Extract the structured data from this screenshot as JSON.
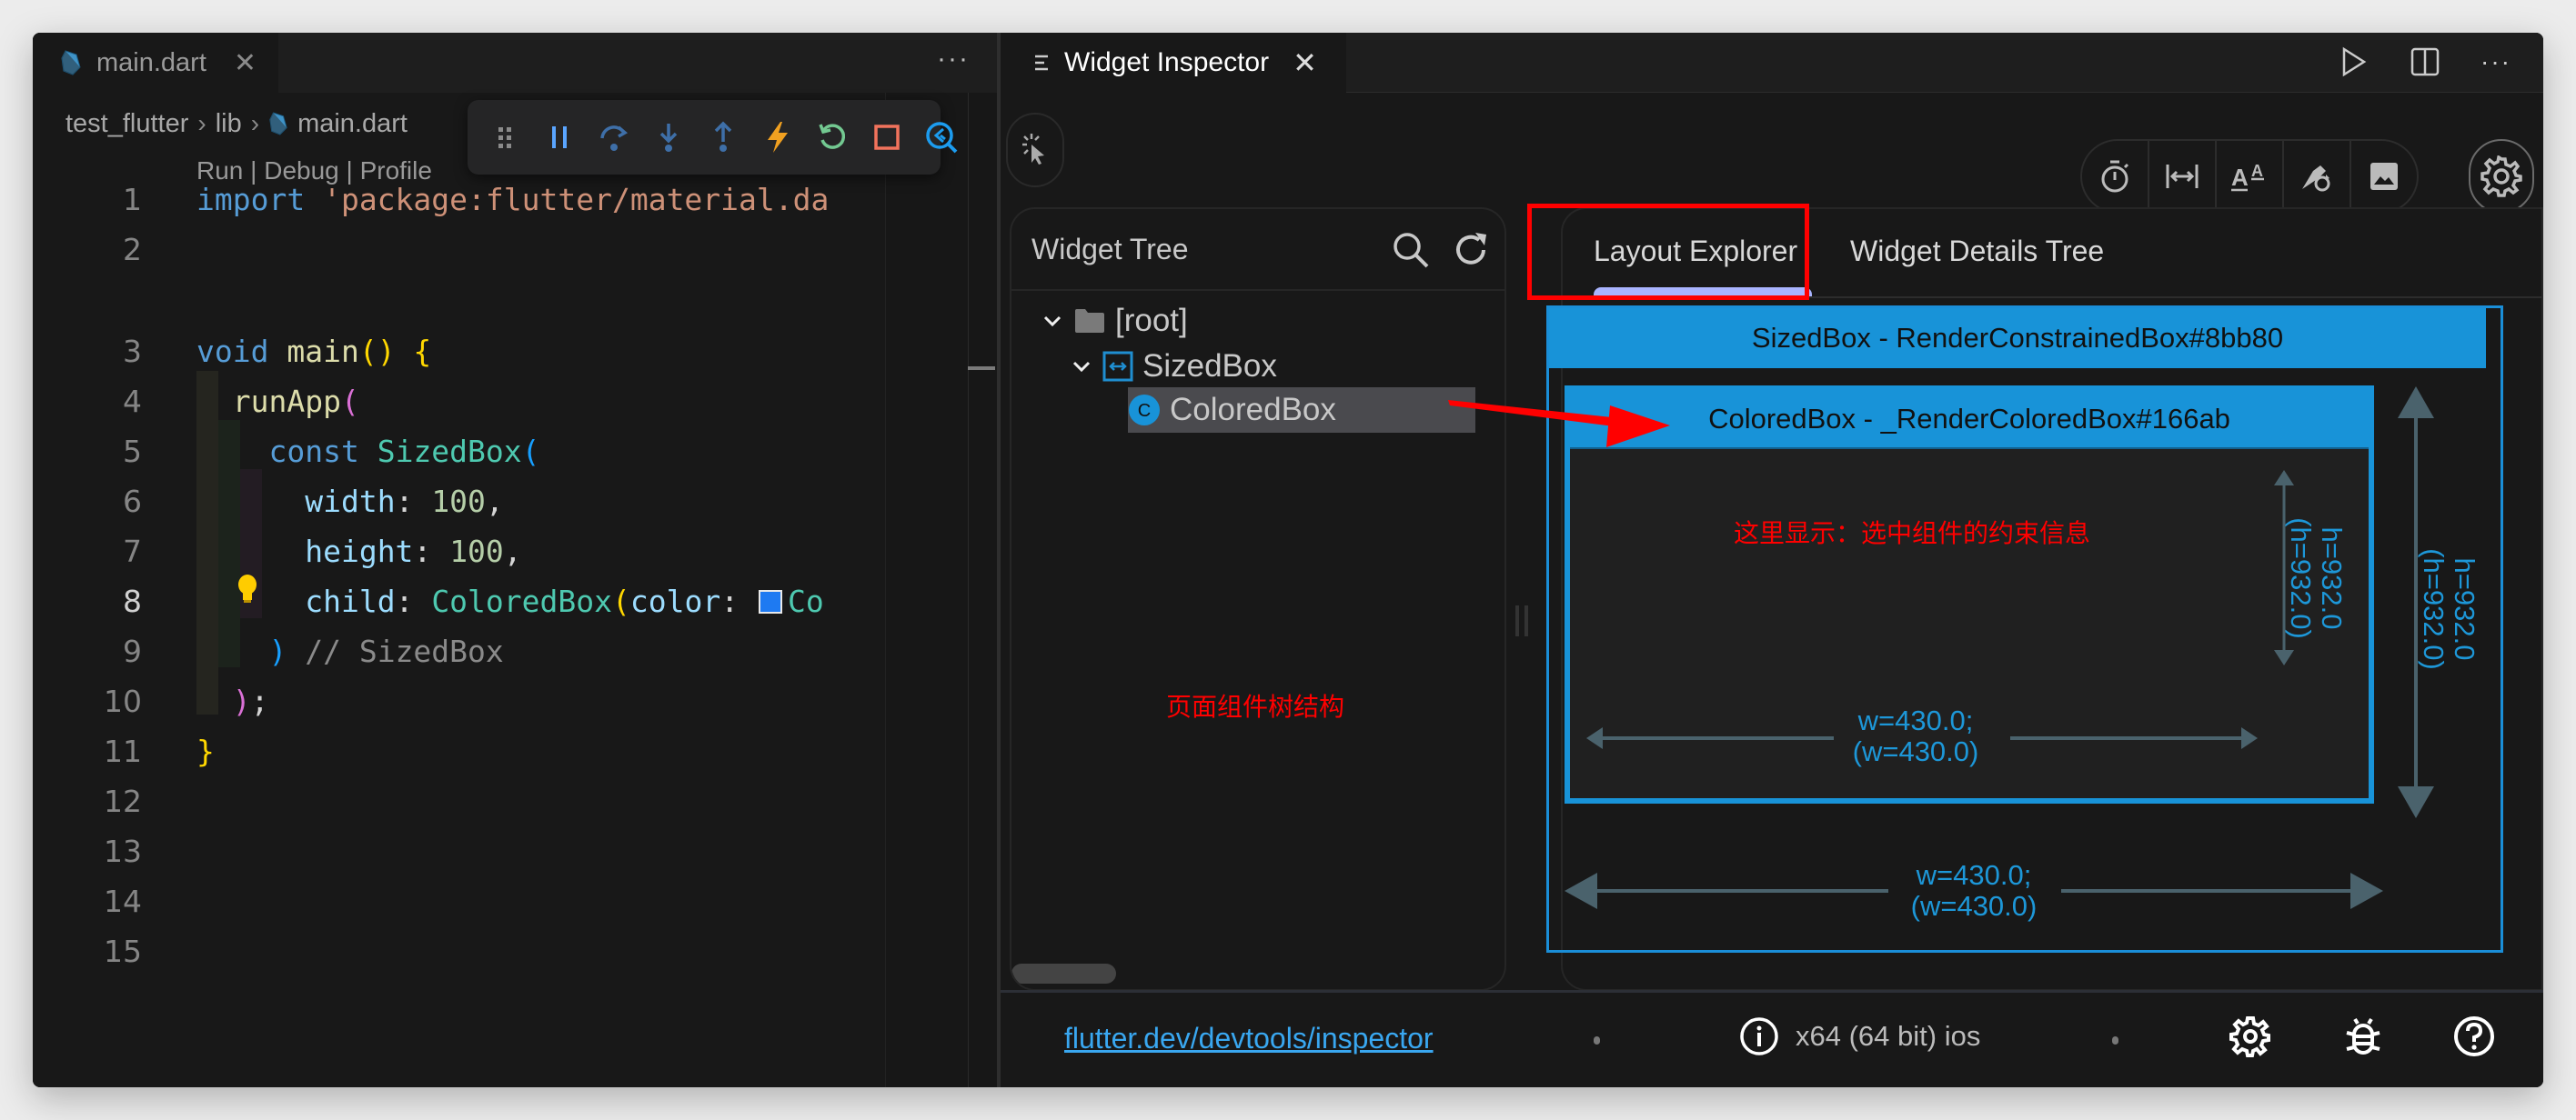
{
  "editor": {
    "tab": {
      "label": "main.dart",
      "icon": "dart-file-icon"
    },
    "more_label": "···",
    "breadcrumb": [
      "test_flutter",
      "lib",
      "main.dart"
    ],
    "debug_toolbar": [
      {
        "name": "drag-handle",
        "color": "#8a8a8a"
      },
      {
        "name": "pause",
        "color": "#5aa5ff"
      },
      {
        "name": "step-over",
        "color": "#3e6fa8"
      },
      {
        "name": "step-into",
        "color": "#3e6fa8"
      },
      {
        "name": "step-out",
        "color": "#3e6fa8"
      },
      {
        "name": "hot-reload",
        "color": "#f0a020"
      },
      {
        "name": "restart",
        "color": "#73c991"
      },
      {
        "name": "stop",
        "color": "#f2735c"
      },
      {
        "name": "open-devtools",
        "color": "#1c9cef"
      }
    ],
    "codelens": {
      "run": "Run",
      "debug": "Debug",
      "profile": "Profile",
      "sep": " | "
    },
    "active_line": 8,
    "lines": [
      {
        "no": "1",
        "tokens": [
          [
            "kw",
            "import "
          ],
          [
            "str",
            "'package:flutter/material.da"
          ]
        ]
      },
      {
        "no": "2",
        "tokens": []
      },
      {
        "no": "3",
        "tokens": [
          [
            "kw",
            "void "
          ],
          [
            "fn",
            "main"
          ],
          [
            "br1",
            "() {"
          ]
        ]
      },
      {
        "no": "4",
        "tokens": [
          [
            "plain",
            "  "
          ],
          [
            "fn",
            "runApp"
          ],
          [
            "br2",
            "("
          ]
        ]
      },
      {
        "no": "5",
        "tokens": [
          [
            "plain",
            "    "
          ],
          [
            "kw",
            "const "
          ],
          [
            "cls",
            "SizedBox"
          ],
          [
            "br3",
            "("
          ]
        ]
      },
      {
        "no": "6",
        "tokens": [
          [
            "plain",
            "      "
          ],
          [
            "prop",
            "width"
          ],
          [
            "plain",
            ": "
          ],
          [
            "num",
            "100"
          ],
          [
            "plain",
            ","
          ]
        ]
      },
      {
        "no": "7",
        "tokens": [
          [
            "plain",
            "      "
          ],
          [
            "prop",
            "height"
          ],
          [
            "plain",
            ": "
          ],
          [
            "num",
            "100"
          ],
          [
            "plain",
            ","
          ]
        ]
      },
      {
        "no": "8",
        "tokens": [
          [
            "plain",
            "      "
          ],
          [
            "prop",
            "child"
          ],
          [
            "plain",
            ": "
          ],
          [
            "cls",
            "ColoredBox"
          ],
          [
            "br1",
            "("
          ],
          [
            "prop",
            "color"
          ],
          [
            "plain",
            ": "
          ],
          [
            "swatch",
            ""
          ],
          [
            "cls",
            "Co"
          ]
        ]
      },
      {
        "no": "9",
        "tokens": [
          [
            "plain",
            "    "
          ],
          [
            "br3",
            ")"
          ],
          [
            "cmt",
            " // SizedBox"
          ]
        ]
      },
      {
        "no": "10",
        "tokens": [
          [
            "plain",
            "  "
          ],
          [
            "br2",
            ")"
          ],
          [
            "plain",
            ";"
          ]
        ]
      },
      {
        "no": "11",
        "tokens": [
          [
            "br1",
            "}"
          ]
        ]
      },
      {
        "no": "12",
        "tokens": []
      },
      {
        "no": "13",
        "tokens": []
      },
      {
        "no": "14",
        "tokens": []
      },
      {
        "no": "15",
        "tokens": []
      }
    ]
  },
  "inspector": {
    "tab_label": "Widget Inspector",
    "header_actions": [
      "run-icon",
      "split-editor-icon",
      "more-icon"
    ],
    "more_label": "···",
    "toolbar": [
      "slow-animations-icon",
      "show-guidelines-icon",
      "show-baselines-icon",
      "highlight-repaints-icon",
      "highlight-oversized-images-icon"
    ],
    "widget_tree": {
      "title": "Widget Tree",
      "nodes": [
        {
          "label": "[root]",
          "depth": 0,
          "icon": "folder-icon",
          "expanded": true,
          "selected": false
        },
        {
          "label": "SizedBox",
          "depth": 1,
          "icon": "sized-box-icon",
          "expanded": true,
          "selected": false
        },
        {
          "label": "ColoredBox",
          "depth": 2,
          "icon": "widget-c-icon",
          "badge": "C",
          "expanded": false,
          "selected": true
        }
      ]
    },
    "details": {
      "tabs": [
        {
          "label": "Layout Explorer",
          "active": true
        },
        {
          "label": "Widget Details Tree",
          "active": false
        }
      ],
      "layout": {
        "parent_label": "SizedBox - RenderConstrainedBox#8bb80",
        "child_label": "ColoredBox - _RenderColoredBox#166ab",
        "child_width": "w=430.0;\n(w=430.0)",
        "child_height": "h=932.0\n(h=932.0)",
        "parent_width": "w=430.0;\n(w=430.0)",
        "parent_height": "h=932.0\n(h=932.0)"
      }
    },
    "annotations": {
      "tree": "页面组件树结构",
      "constraint": "这里显示：选中组件的约束信息"
    },
    "status": {
      "docs_link": "flutter.dev/devtools/inspector",
      "device": "x64 (64 bit) ios",
      "icons": [
        "settings-icon",
        "bug-icon",
        "help-icon"
      ]
    }
  },
  "colors": {
    "accent_blue": "#1893d8",
    "annotation_red": "#ff0000",
    "tab_indicator": "#a9b4ff",
    "link": "#39a7f0"
  }
}
